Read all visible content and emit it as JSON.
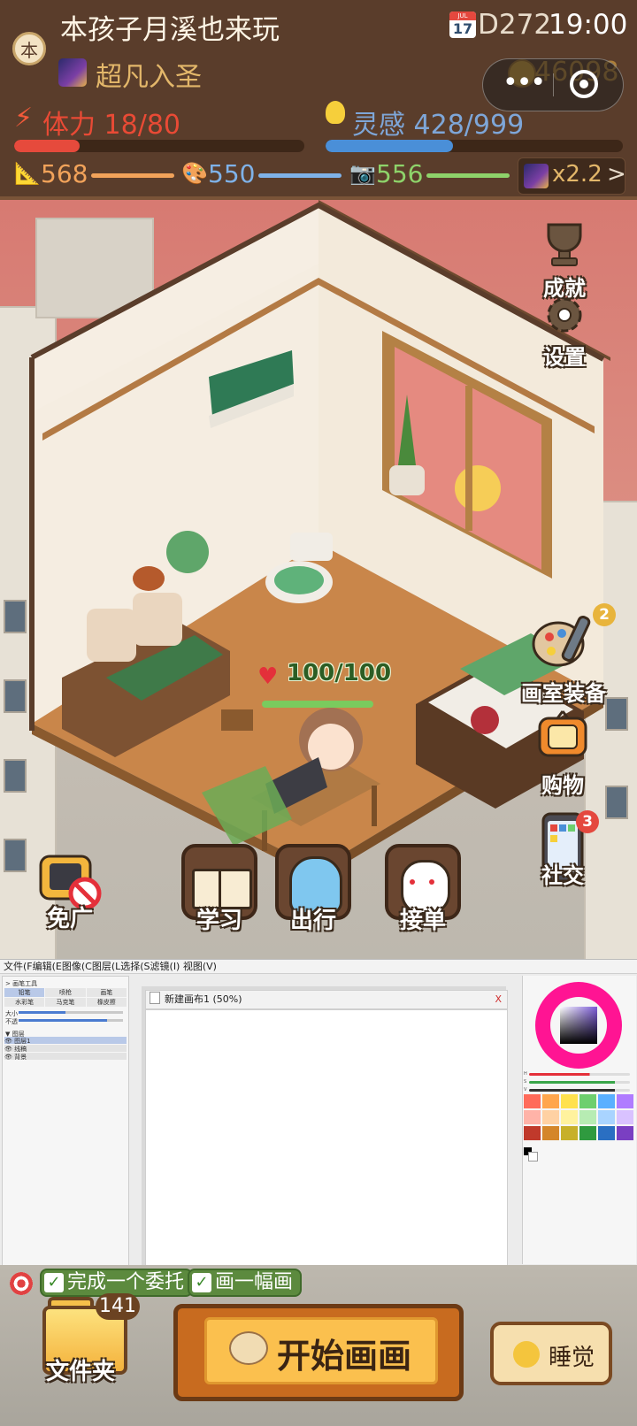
{
  "header": {
    "avatar_char": "本",
    "username": "本孩子月溪也来玩",
    "calendar_icon_month": "JUL",
    "calendar_icon_day": "17",
    "day": "D272",
    "time": "19:00",
    "rank_icon": "galaxy-icon",
    "rank": "超凡入圣",
    "coins": "46098",
    "stamina_label": "体力 18/80",
    "stamina_value": 18,
    "stamina_max": 80,
    "inspiration_label": "灵感 428/999",
    "inspiration_value": 428,
    "inspiration_max": 999,
    "stats": [
      {
        "icon": "ruler-icon",
        "value": "568",
        "color": "#f2a35a"
      },
      {
        "icon": "palette-icon",
        "value": "550",
        "color": "#7fb2e8"
      },
      {
        "icon": "camera-icon",
        "value": "556",
        "color": "#8ed36a"
      }
    ],
    "multiplier": "x2.2",
    "multiplier_chevron": ">"
  },
  "colors": {
    "stamina": "#e64a3c",
    "inspiration": "#4a8fd8",
    "hud_bg": "#5a3d2b",
    "accent_gold": "#e3b76a"
  },
  "scene": {
    "right_buttons": [
      {
        "label": "成就",
        "icon": "trophy-icon"
      },
      {
        "label": "设置",
        "icon": "gear-icon"
      },
      {
        "label": "画室装备",
        "icon": "palette-brush-icon",
        "badge": "2"
      },
      {
        "label": "购物",
        "icon": "tv-shop-icon"
      },
      {
        "label": "社交",
        "icon": "phone-icon",
        "badge": "3"
      }
    ],
    "hp_text": "100/100",
    "actions": [
      {
        "label": "免广",
        "icon": "no-ads-tv-icon"
      },
      {
        "label": "学习",
        "icon": "book-icon"
      },
      {
        "label": "出行",
        "icon": "ghost-icon"
      },
      {
        "label": "接单",
        "icon": "rabbit-icon"
      }
    ]
  },
  "paint_app": {
    "menu": "文件(F编辑(E图像(C图层(L选择(S滤镜(I) 视图(V)",
    "tool_panel_title": "> 画笔工具",
    "tools": [
      "铅笔",
      "喷枪",
      "画笔",
      "水彩笔",
      "马克笔",
      "橡皮擦"
    ],
    "size_label": "大小",
    "opacity_label": "不透",
    "layers_title": "▼ 图层",
    "layers": [
      "👁 图层1",
      "👁 线稿",
      "👁 背景"
    ],
    "canvas_tab": "新建画布1 (50%)",
    "close": "X",
    "slider_labels": [
      "H",
      "S",
      "V"
    ],
    "swatches": [
      "#ff6b5a",
      "#ffa64d",
      "#ffe14d",
      "#6ecf6e",
      "#5ab0ff",
      "#b07cff",
      "#ffb3a8",
      "#ffd1a3",
      "#fff29e",
      "#b7ecb3",
      "#a9d4ff",
      "#d9c2ff",
      "#c0392b",
      "#d4862a",
      "#c7b02a",
      "#2f9a3f",
      "#2a6fc2",
      "#7a3fc2"
    ]
  },
  "bottom": {
    "quests": [
      "完成一个委托",
      "画一幅画"
    ],
    "folder_count": "141",
    "folder_label": "文件夹",
    "start_label": "开始画画",
    "sleep_label": "睡觉"
  }
}
